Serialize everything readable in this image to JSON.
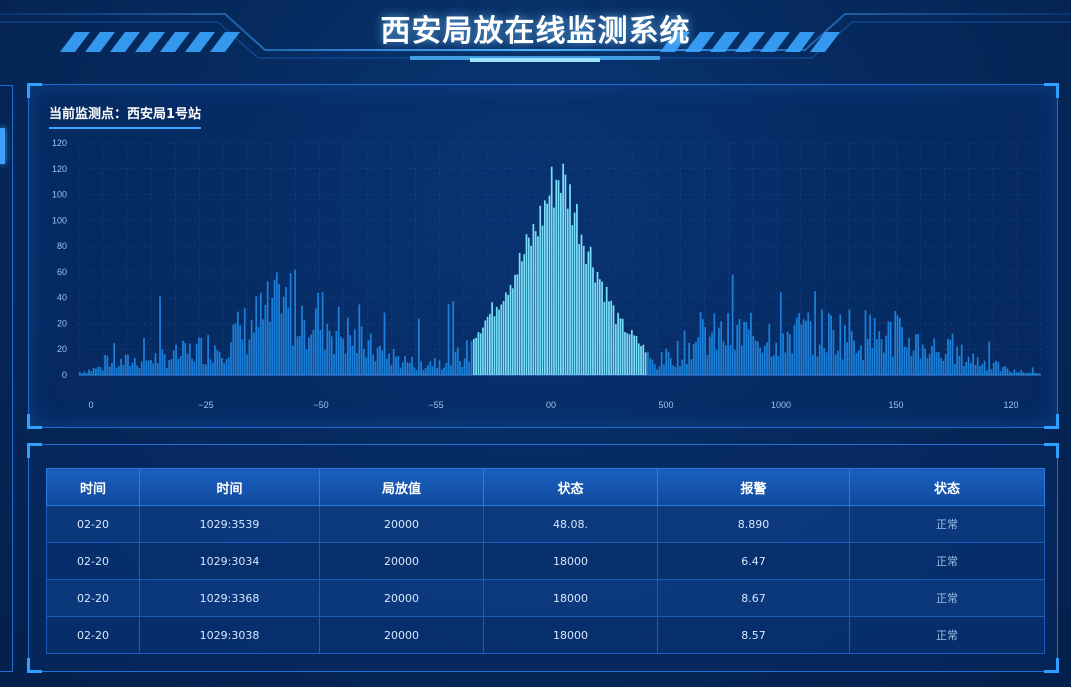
{
  "title": "西安局放在线监测系统",
  "station_label": "当前监测点：西安局1号站",
  "colors": {
    "accent": "#3fa0ff",
    "bar": "#1e8ff0",
    "peak": "#7ee8ff",
    "grid": "#2a5fa8"
  },
  "chart_data": {
    "type": "bar",
    "title": "",
    "xlabel": "",
    "ylabel": "",
    "ylim": [
      0,
      120
    ],
    "y_ticks": [
      "120",
      "120",
      "100",
      "100",
      "80",
      "60",
      "40",
      "20",
      "20",
      "0"
    ],
    "x_ticks": [
      "0",
      "−25",
      "−50",
      "−55",
      "00",
      "500",
      "1000",
      "150",
      "120"
    ],
    "envelope": [
      {
        "pos": 0.0,
        "value": 2
      },
      {
        "pos": 0.05,
        "value": 10
      },
      {
        "pos": 0.1,
        "value": 14
      },
      {
        "pos": 0.15,
        "value": 24
      },
      {
        "pos": 0.2,
        "value": 45
      },
      {
        "pos": 0.225,
        "value": 52
      },
      {
        "pos": 0.25,
        "value": 42
      },
      {
        "pos": 0.3,
        "value": 20
      },
      {
        "pos": 0.35,
        "value": 8
      },
      {
        "pos": 0.4,
        "value": 14
      },
      {
        "pos": 0.43,
        "value": 35
      },
      {
        "pos": 0.46,
        "value": 62
      },
      {
        "pos": 0.48,
        "value": 85
      },
      {
        "pos": 0.49,
        "value": 100
      },
      {
        "pos": 0.5,
        "value": 110
      },
      {
        "pos": 0.51,
        "value": 98
      },
      {
        "pos": 0.53,
        "value": 68
      },
      {
        "pos": 0.56,
        "value": 30
      },
      {
        "pos": 0.6,
        "value": 8
      },
      {
        "pos": 0.65,
        "value": 28
      },
      {
        "pos": 0.7,
        "value": 30
      },
      {
        "pos": 0.8,
        "value": 32
      },
      {
        "pos": 0.85,
        "value": 28
      },
      {
        "pos": 0.93,
        "value": 12
      },
      {
        "pos": 0.97,
        "value": 3
      },
      {
        "pos": 1.0,
        "value": 1
      }
    ]
  },
  "table": {
    "headers": [
      "时间",
      "时间",
      "局放值",
      "状态",
      "报警",
      "状态"
    ],
    "rows": [
      [
        "02-20",
        "1029:3539",
        "20000",
        "48.08.",
        "8.890",
        "正常"
      ],
      [
        "02-20",
        "1029:3034",
        "20000",
        "18000",
        "6.47",
        "正常"
      ],
      [
        "02-20",
        "1029:3368",
        "20000",
        "18000",
        "8.67",
        "正常"
      ],
      [
        "02-20",
        "1029:3038",
        "20000",
        "18000",
        "8.57",
        "正常"
      ]
    ]
  }
}
